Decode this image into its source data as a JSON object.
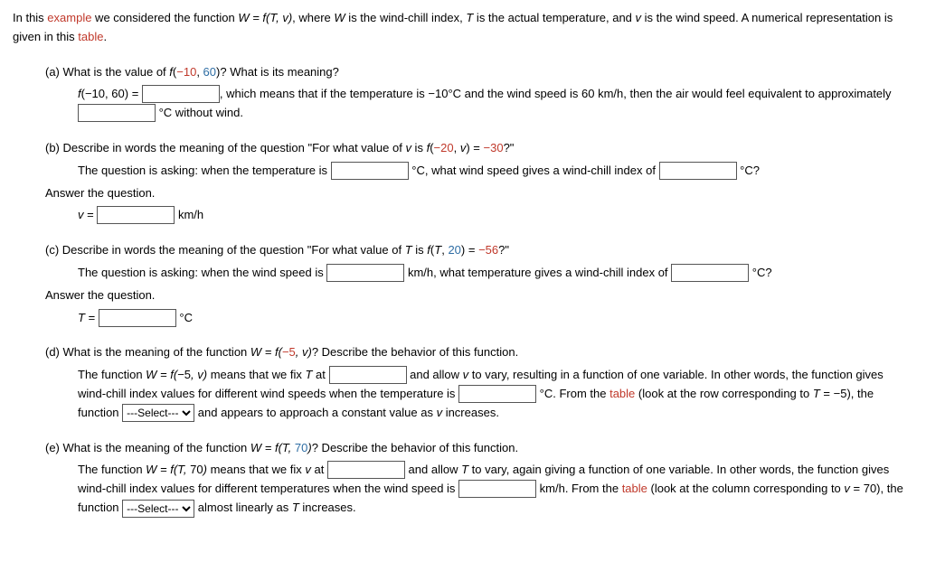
{
  "intro": {
    "t1": "In this ",
    "example": "example",
    "t2": " we considered the function ",
    "func": "W = f(T, v)",
    "t3": ", where ",
    "w_is": " is the wind-chill index, ",
    "t_is": " is the actual temperature, and ",
    "v_is": " is the wind speed. A numerical representation is given in this ",
    "table": "table",
    "period": "."
  },
  "a": {
    "prompt_1": "(a) What is the value of ",
    "func": "f",
    "lp": "(",
    "neg10": "−10",
    "comma": ", ",
    "sixty": "60",
    "rp": ")",
    "prompt_2": "? What is its meaning?",
    "eq": " = ",
    "after_box": ", which means that if the temperature is −10°C and the wind speed is 60 km/h, then the air would feel equivalent to approximately ",
    "after_box2": " °C without wind."
  },
  "b": {
    "prompt_1": "(b) Describe in words the meaning of the question \"For what value of ",
    "v": "v",
    "is": " is ",
    "f": "f",
    "lp": "(",
    "neg20": "−20",
    "comma": ", ",
    "rp": ")",
    "eq": " = ",
    "neg30": "−30",
    "q": "?\"",
    "line2a": "The question is asking: when the temperature is ",
    "line2b": " °C, what wind speed gives a wind-chill index of ",
    "line2c": " °C?",
    "ans_label": "Answer the question.",
    "veq": " = ",
    "kmh": " km/h"
  },
  "c": {
    "prompt_1": "(c) Describe in words the meaning of the question \"For what value of ",
    "T": "T",
    "is": " is ",
    "f": "f",
    "lp": "(",
    "comma": ", ",
    "twenty": "20",
    "rp": ")",
    "eq": " = ",
    "neg56": "−56",
    "q": "?\"",
    "line2a": "The question is asking: when the wind speed is ",
    "line2b": " km/h, what temperature gives a wind-chill index of ",
    "line2c": " °C?",
    "ans_label": "Answer the question.",
    "Teq": " = ",
    "degc": " °C"
  },
  "d": {
    "prompt_1": "(d) What is the meaning of the function ",
    "func": "W = f(",
    "neg5": "−5",
    "after": ", v)",
    "prompt_2": "? Describe the behavior of this function.",
    "l1a": "The function ",
    "l1b": " means that we fix ",
    "at": " at ",
    "l1c": " and allow ",
    "l1d": " to vary, resulting in a function of one variable. In other words, the function gives wind-chill index values for different wind speeds when the temperature is ",
    "l1e": " °C. From the ",
    "table": "table",
    "l1f": " (look at the row corresponding to ",
    "Teq": " = −5), the function ",
    "l1g": " and appears to approach a constant value as ",
    "l1h": " increases."
  },
  "e": {
    "prompt_1": "(e) What is the meaning of the function ",
    "func_pre": "W = f(T, ",
    "seventy": "70",
    "func_post": ")",
    "prompt_2": "? Describe the behavior of this function.",
    "l1a": "The function ",
    "l1b": " means that we fix ",
    "at": " at ",
    "l1c": " and allow ",
    "l1d": " to vary, again giving a function of one variable. In other words, the function gives wind-chill index values for different temperatures when the wind speed is ",
    "l1e": " km/h. From the ",
    "table": "table",
    "l1f": " (look at the column corresponding to ",
    "veq": " = 70), the function ",
    "l1g": " almost linearly as ",
    "l1h": " increases."
  },
  "select_placeholder": "---Select---"
}
